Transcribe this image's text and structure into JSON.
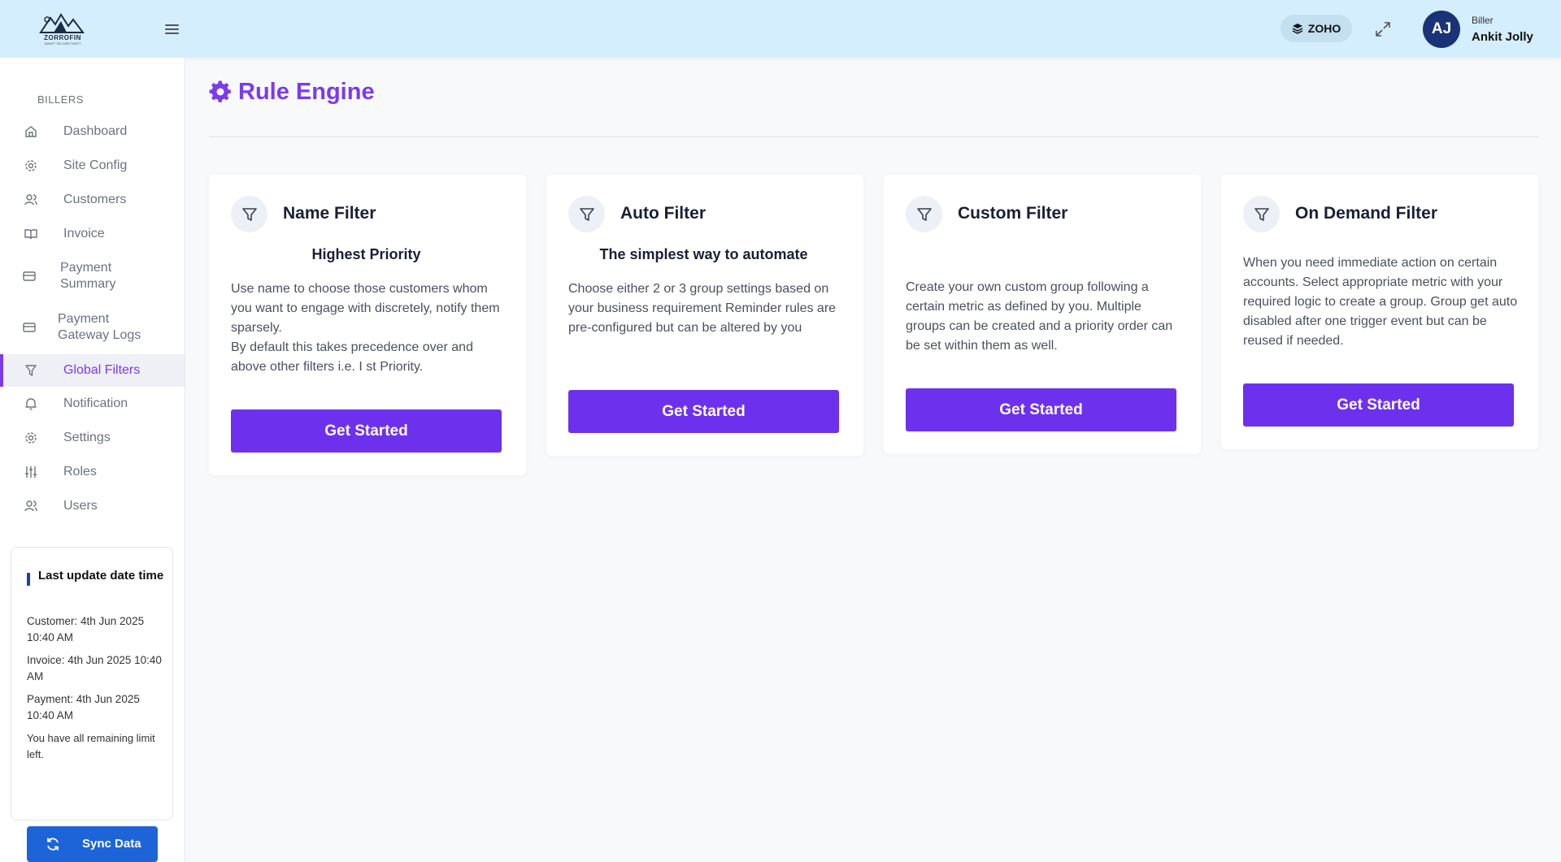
{
  "header": {
    "logo_text": "ZORROFIN",
    "logo_tagline": "SMART SECURE SWIFT",
    "integration_label": "ZOHO",
    "user_role": "Biller",
    "user_name": "Ankit Jolly",
    "user_initials": "AJ"
  },
  "sidebar": {
    "section_title": "BILLERS",
    "items": [
      {
        "label": "Dashboard",
        "icon": "home-icon"
      },
      {
        "label": "Site Config",
        "icon": "gear-icon"
      },
      {
        "label": "Customers",
        "icon": "users-icon"
      },
      {
        "label": "Invoice",
        "icon": "book-icon"
      },
      {
        "label": "Payment Summary",
        "icon": "card-icon"
      },
      {
        "label": "Payment Gateway Logs",
        "icon": "card-icon"
      },
      {
        "label": "Global Filters",
        "icon": "filter-icon",
        "active": true
      },
      {
        "label": "Notification",
        "icon": "bell-icon"
      },
      {
        "label": "Settings",
        "icon": "gear-icon"
      },
      {
        "label": "Roles",
        "icon": "sliders-icon"
      },
      {
        "label": "Users",
        "icon": "users-icon"
      }
    ],
    "update_box": {
      "title": "Last update date time",
      "customer": "Customer: 4th Jun 2025 10:40 AM",
      "invoice": "Invoice: 4th Jun 2025 10:40 AM",
      "payment": "Payment: 4th Jun 2025 10:40 AM",
      "limit_note": "You have all remaining limit left.",
      "sync_label": "Sync Data"
    }
  },
  "main": {
    "title": "Rule Engine",
    "title_icon": "gear-icon",
    "cards": [
      {
        "title": "Name Filter",
        "subtitle": "Highest Priority",
        "description": "Use name to choose those customers whom you want to engage with discretely, notify them sparsely.\nBy default this takes precedence over and above other filters i.e. I st Priority.",
        "button": "Get Started"
      },
      {
        "title": "Auto Filter",
        "subtitle": "The simplest way to automate",
        "description": "Choose either 2 or 3 group settings based on your business requirement Reminder rules are pre-configured but can be altered by you",
        "button": "Get Started"
      },
      {
        "title": "Custom Filter",
        "subtitle": "",
        "description": "Create your own custom group following a certain metric as defined by you. Multiple groups can be created and a priority order can be set within them as well.",
        "button": "Get Started"
      },
      {
        "title": "On Demand Filter",
        "subtitle": "",
        "description": "When you need immediate action on certain accounts. Select appropriate metric with your required logic to create a group. Group get auto disabled after one trigger event but can be reused if needed.",
        "button": "Get Started"
      }
    ]
  },
  "colors": {
    "accent": "#7c3aed",
    "button": "#6d31ed",
    "header_bg": "#d4eefd",
    "sync_button": "#1d64d8",
    "avatar_bg": "#1a3276"
  }
}
